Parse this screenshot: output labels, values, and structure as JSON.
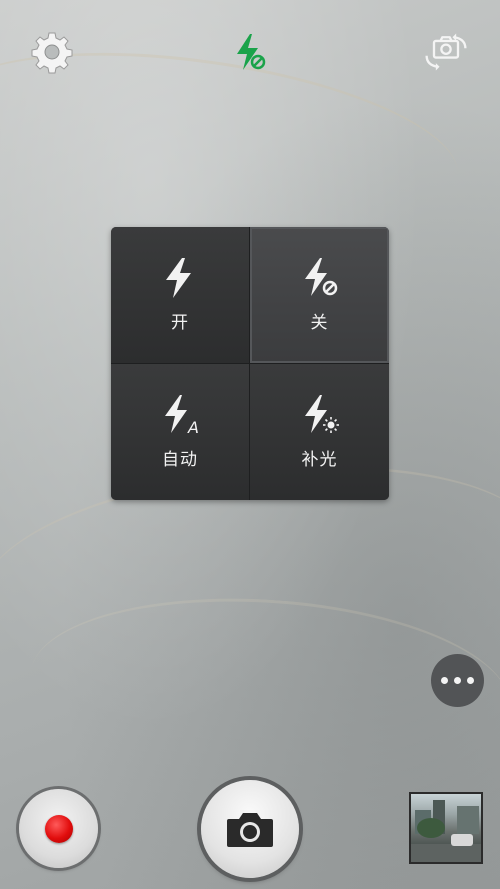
{
  "top_bar": {
    "settings_icon": "gear-icon",
    "flash_status_icon": "flash-off-icon",
    "flash_status_color": "#1aa34a",
    "switch_camera_icon": "camera-switch-icon"
  },
  "flash_menu": {
    "selected": "off",
    "options": [
      {
        "id": "on",
        "label": "开",
        "icon": "flash-on-icon"
      },
      {
        "id": "off",
        "label": "关",
        "icon": "flash-off-icon"
      },
      {
        "id": "auto",
        "label": "自动",
        "icon": "flash-auto-icon"
      },
      {
        "id": "fill",
        "label": "补光",
        "icon": "flash-fill-light-icon"
      }
    ]
  },
  "more_button": {
    "icon": "more-dots-icon"
  },
  "bottom_bar": {
    "record_icon": "record-video-icon",
    "record_color": "#e10d0d",
    "shutter_icon": "camera-shutter-icon",
    "thumbnail": "last-photo-thumbnail"
  }
}
